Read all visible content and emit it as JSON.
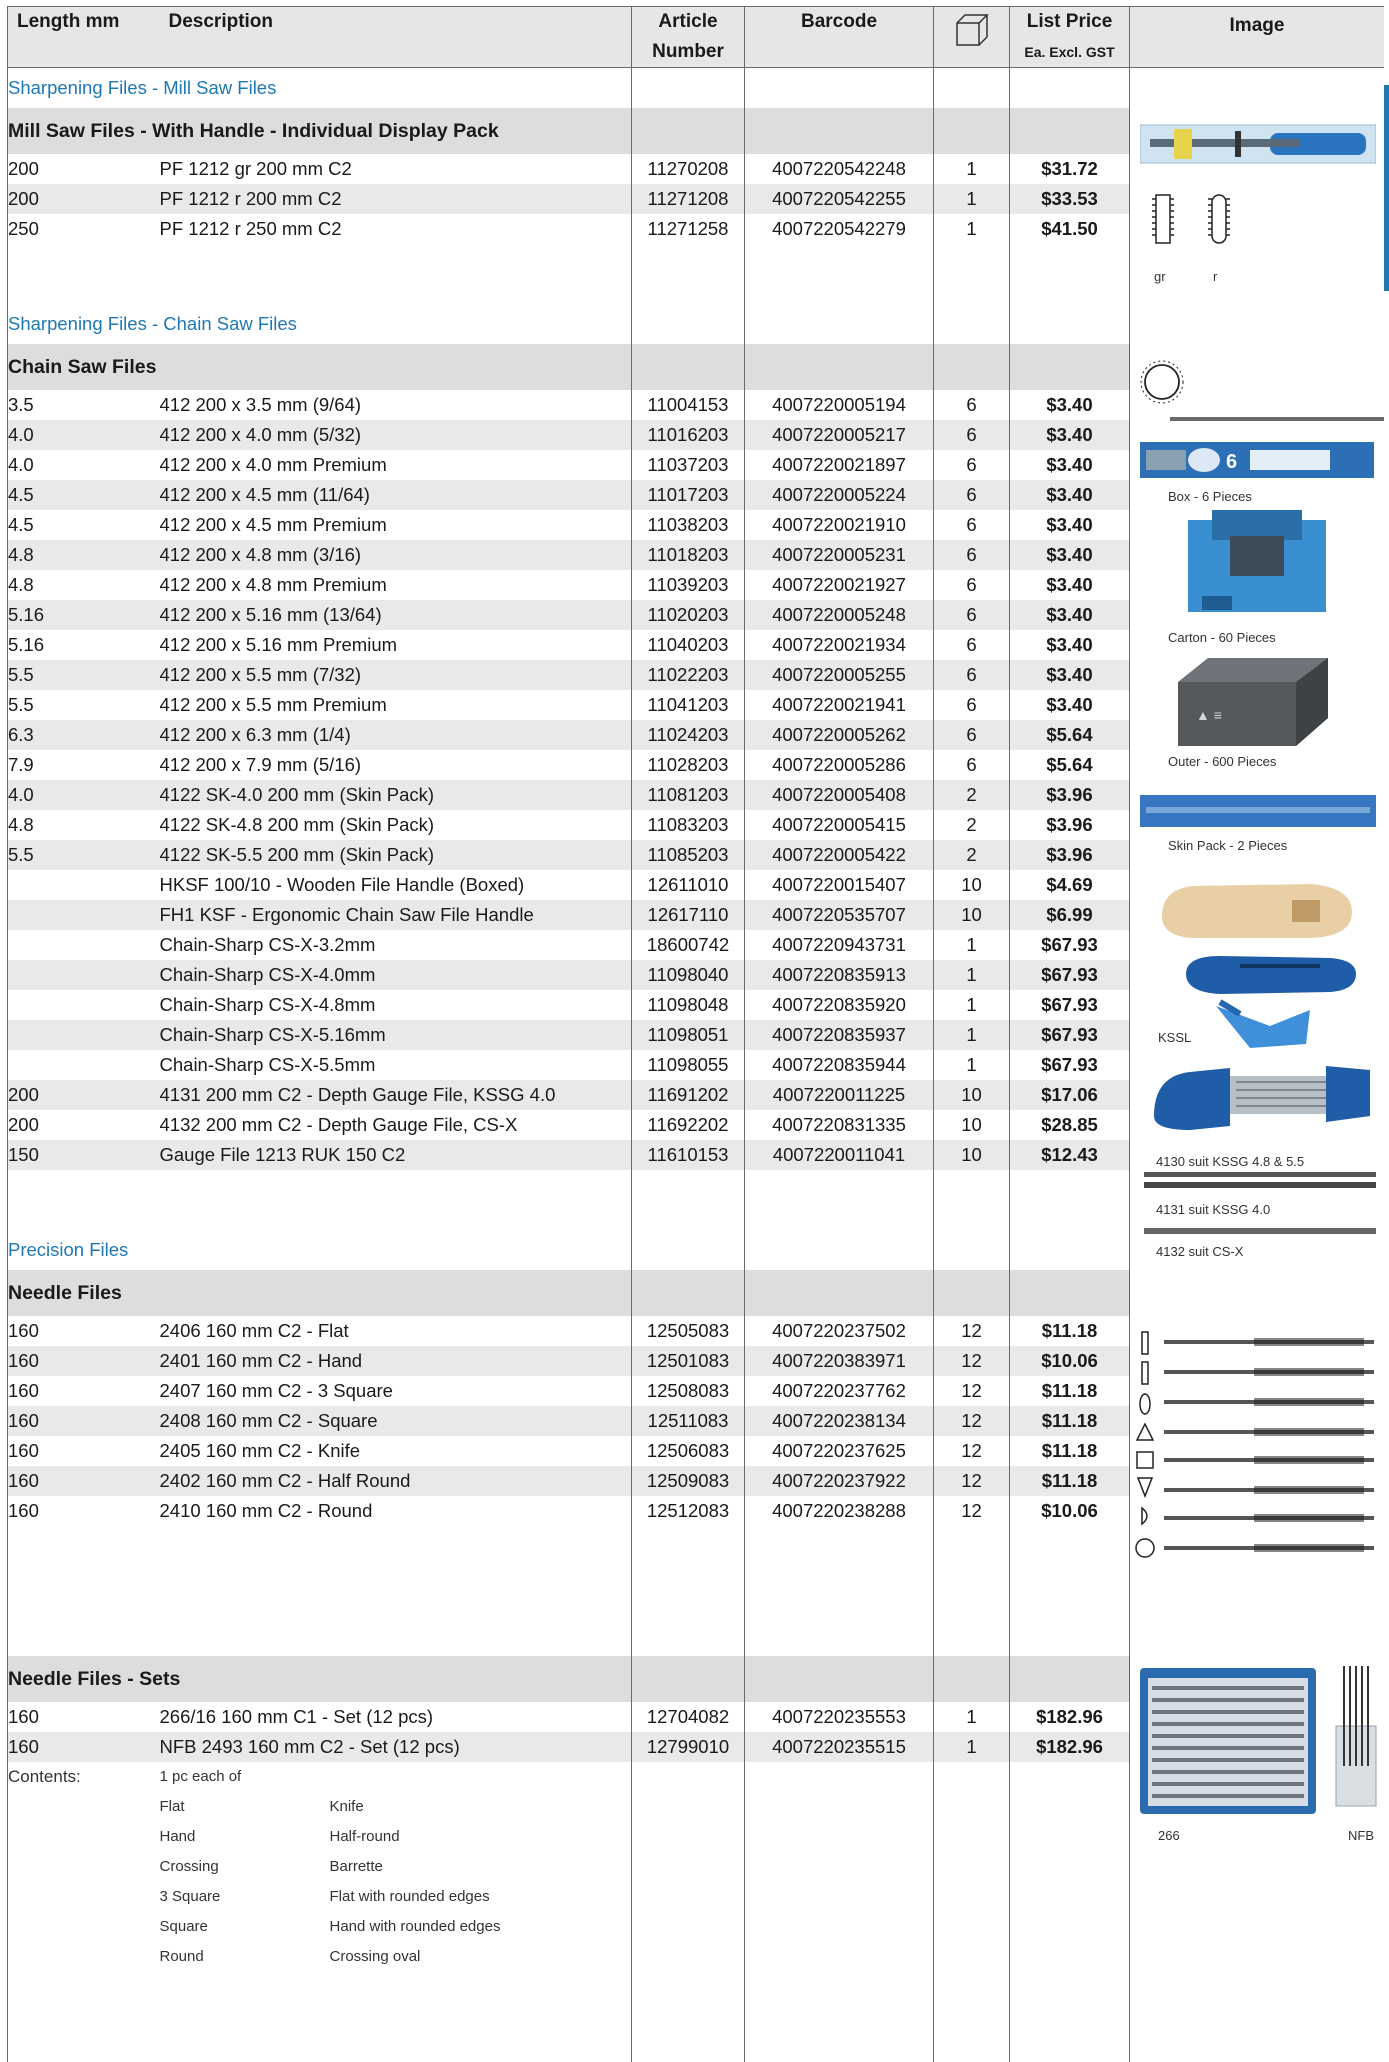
{
  "header": {
    "length": "Length mm",
    "description": "Description",
    "article1": "Article",
    "article2": "Number",
    "barcode": "Barcode",
    "price1": "List Price",
    "price2": "Ea. Excl. GST",
    "image": "Image"
  },
  "sections": [
    {
      "title": "Sharpening Files - Mill Saw Files",
      "group": "Mill Saw Files - With Handle - Individual Display Pack",
      "rows": [
        {
          "len": "200",
          "desc": "PF 1212 gr 200 mm C2",
          "art": "11270208",
          "bar": "4007220542248",
          "qty": "1",
          "price": "$31.72"
        },
        {
          "len": "200",
          "desc": "PF 1212 r 200 mm C2",
          "art": "11271208",
          "bar": "4007220542255",
          "qty": "1",
          "price": "$33.53"
        },
        {
          "len": "250",
          "desc": "PF 1212 r 250 mm C2",
          "art": "11271258",
          "bar": "4007220542279",
          "qty": "1",
          "price": "$41.50"
        }
      ],
      "trailing_spacers": 2
    },
    {
      "title": "Sharpening Files - Chain Saw Files",
      "group": "Chain Saw Files",
      "rows": [
        {
          "len": "3.5",
          "desc": "412 200 x 3.5 mm (9/64)",
          "art": "11004153",
          "bar": "4007220005194",
          "qty": "6",
          "price": "$3.40"
        },
        {
          "len": "4.0",
          "desc": "412 200 x 4.0 mm (5/32)",
          "art": "11016203",
          "bar": "4007220005217",
          "qty": "6",
          "price": "$3.40"
        },
        {
          "len": "4.0",
          "desc": "412 200 x 4.0 mm Premium",
          "art": "11037203",
          "bar": "4007220021897",
          "qty": "6",
          "price": "$3.40"
        },
        {
          "len": "4.5",
          "desc": "412 200 x 4.5 mm (11/64)",
          "art": "11017203",
          "bar": "4007220005224",
          "qty": "6",
          "price": "$3.40"
        },
        {
          "len": "4.5",
          "desc": "412 200 x 4.5 mm Premium",
          "art": "11038203",
          "bar": "4007220021910",
          "qty": "6",
          "price": "$3.40"
        },
        {
          "len": "4.8",
          "desc": "412 200 x 4.8 mm (3/16)",
          "art": "11018203",
          "bar": "4007220005231",
          "qty": "6",
          "price": "$3.40"
        },
        {
          "len": "4.8",
          "desc": "412 200 x 4.8 mm Premium",
          "art": "11039203",
          "bar": "4007220021927",
          "qty": "6",
          "price": "$3.40"
        },
        {
          "len": "5.16",
          "desc": "412 200 x 5.16 mm (13/64)",
          "art": "11020203",
          "bar": "4007220005248",
          "qty": "6",
          "price": "$3.40"
        },
        {
          "len": "5.16",
          "desc": "412 200 x 5.16 mm Premium",
          "art": "11040203",
          "bar": "4007220021934",
          "qty": "6",
          "price": "$3.40"
        },
        {
          "len": "5.5",
          "desc": "412 200 x 5.5 mm (7/32)",
          "art": "11022203",
          "bar": "4007220005255",
          "qty": "6",
          "price": "$3.40"
        },
        {
          "len": "5.5",
          "desc": "412 200 x 5.5 mm Premium",
          "art": "11041203",
          "bar": "4007220021941",
          "qty": "6",
          "price": "$3.40"
        },
        {
          "len": "6.3",
          "desc": "412 200 x 6.3 mm (1/4)",
          "art": "11024203",
          "bar": "4007220005262",
          "qty": "6",
          "price": "$5.64"
        },
        {
          "len": "7.9",
          "desc": "412 200 x 7.9 mm (5/16)",
          "art": "11028203",
          "bar": "4007220005286",
          "qty": "6",
          "price": "$5.64"
        },
        {
          "len": "4.0",
          "desc": "4122 SK-4.0 200 mm (Skin Pack)",
          "art": "11081203",
          "bar": "4007220005408",
          "qty": "2",
          "price": "$3.96"
        },
        {
          "len": "4.8",
          "desc": "4122 SK-4.8 200 mm (Skin Pack)",
          "art": "11083203",
          "bar": "4007220005415",
          "qty": "2",
          "price": "$3.96"
        },
        {
          "len": "5.5",
          "desc": "4122 SK-5.5 200 mm (Skin Pack)",
          "art": "11085203",
          "bar": "4007220005422",
          "qty": "2",
          "price": "$3.96"
        },
        {
          "len": "",
          "desc": "HKSF 100/10 - Wooden File Handle (Boxed)",
          "art": "12611010",
          "bar": "4007220015407",
          "qty": "10",
          "price": "$4.69"
        },
        {
          "len": "",
          "desc": "FH1 KSF - Ergonomic Chain Saw File Handle",
          "art": "12617110",
          "bar": "4007220535707",
          "qty": "10",
          "price": "$6.99"
        },
        {
          "len": "",
          "desc": "Chain-Sharp CS-X-3.2mm",
          "art": "18600742",
          "bar": "4007220943731",
          "qty": "1",
          "price": "$67.93"
        },
        {
          "len": "",
          "desc": "Chain-Sharp CS-X-4.0mm",
          "art": "11098040",
          "bar": "4007220835913",
          "qty": "1",
          "price": "$67.93"
        },
        {
          "len": "",
          "desc": "Chain-Sharp CS-X-4.8mm",
          "art": "11098048",
          "bar": "4007220835920",
          "qty": "1",
          "price": "$67.93"
        },
        {
          "len": "",
          "desc": "Chain-Sharp CS-X-5.16mm",
          "art": "11098051",
          "bar": "4007220835937",
          "qty": "1",
          "price": "$67.93"
        },
        {
          "len": "",
          "desc": "Chain-Sharp CS-X-5.5mm",
          "art": "11098055",
          "bar": "4007220835944",
          "qty": "1",
          "price": "$67.93"
        },
        {
          "len": "200",
          "desc": "4131 200 mm C2 - Depth Gauge File, KSSG 4.0",
          "art": "11691202",
          "bar": "4007220011225",
          "qty": "10",
          "price": "$17.06"
        },
        {
          "len": "200",
          "desc": "4132 200 mm C2 - Depth Gauge File, CS-X",
          "art": "11692202",
          "bar": "4007220831335",
          "qty": "10",
          "price": "$28.85"
        },
        {
          "len": "150",
          "desc": "Gauge File 1213 RUK 150 C2",
          "art": "11610153",
          "bar": "4007220011041",
          "qty": "10",
          "price": "$12.43"
        }
      ],
      "trailing_spacers": 2
    },
    {
      "title": "Precision Files",
      "group": "Needle Files",
      "rows": [
        {
          "len": "160",
          "desc": "2406 160 mm C2 - Flat",
          "art": "12505083",
          "bar": "4007220237502",
          "qty": "12",
          "price": "$11.18"
        },
        {
          "len": "160",
          "desc": "2401 160 mm C2 - Hand",
          "art": "12501083",
          "bar": "4007220383971",
          "qty": "12",
          "price": "$10.06"
        },
        {
          "len": "160",
          "desc": "2407 160 mm C2 - 3 Square",
          "art": "12508083",
          "bar": "4007220237762",
          "qty": "12",
          "price": "$11.18"
        },
        {
          "len": "160",
          "desc": "2408 160 mm C2 - Square",
          "art": "12511083",
          "bar": "4007220238134",
          "qty": "12",
          "price": "$11.18"
        },
        {
          "len": "160",
          "desc": "2405 160 mm C2 - Knife",
          "art": "12506083",
          "bar": "4007220237625",
          "qty": "12",
          "price": "$11.18"
        },
        {
          "len": "160",
          "desc": "2402 160 mm C2 - Half Round",
          "art": "12509083",
          "bar": "4007220237922",
          "qty": "12",
          "price": "$11.18"
        },
        {
          "len": "160",
          "desc": "2410 160 mm C2 - Round",
          "art": "12512083",
          "bar": "4007220238288",
          "qty": "12",
          "price": "$10.06"
        }
      ],
      "trailing_spacers": 3
    },
    {
      "title": "",
      "group": "Needle Files - Sets",
      "rows": [
        {
          "len": "160",
          "desc": "266/16 160 mm C1 - Set (12 pcs)",
          "art": "12704082",
          "bar": "4007220235553",
          "qty": "1",
          "price": "$182.96"
        },
        {
          "len": "160",
          "desc": "NFB 2493 160 mm C2 - Set (12 pcs)",
          "art": "12799010",
          "bar": "4007220235515",
          "qty": "1",
          "price": "$182.96"
        }
      ],
      "trailing_spacers": 0
    }
  ],
  "contents": {
    "label": "Contents:",
    "intro": "1 pc each of",
    "col1": [
      "Flat",
      "Hand",
      "Crossing",
      "3 Square",
      "Square",
      "Round"
    ],
    "col2": [
      "Knife",
      "Half-round",
      "Barrette",
      "Flat with rounded edges",
      "Hand with rounded edges",
      "Crossing oval"
    ]
  },
  "image_captions": {
    "gr": "gr",
    "r": "r",
    "box": "Box - 6 Pieces",
    "carton": "Carton - 60 Pieces",
    "outer": "Outer - 600 Pieces",
    "skin": "Skin Pack - 2 Pieces",
    "kssl": "KSSL",
    "k4130": "4130 suit KSSG 4.8 & 5.5",
    "k4131": "4131 suit KSSG 4.0",
    "k4132": "4132 suit CS-X",
    "set266": "266",
    "nfb": "NFB"
  },
  "colors": {
    "accent": "#1f78b4",
    "row_alt": "#e9e9e9",
    "group_bg": "#dddddd",
    "header_bg": "#e6e6e6"
  }
}
